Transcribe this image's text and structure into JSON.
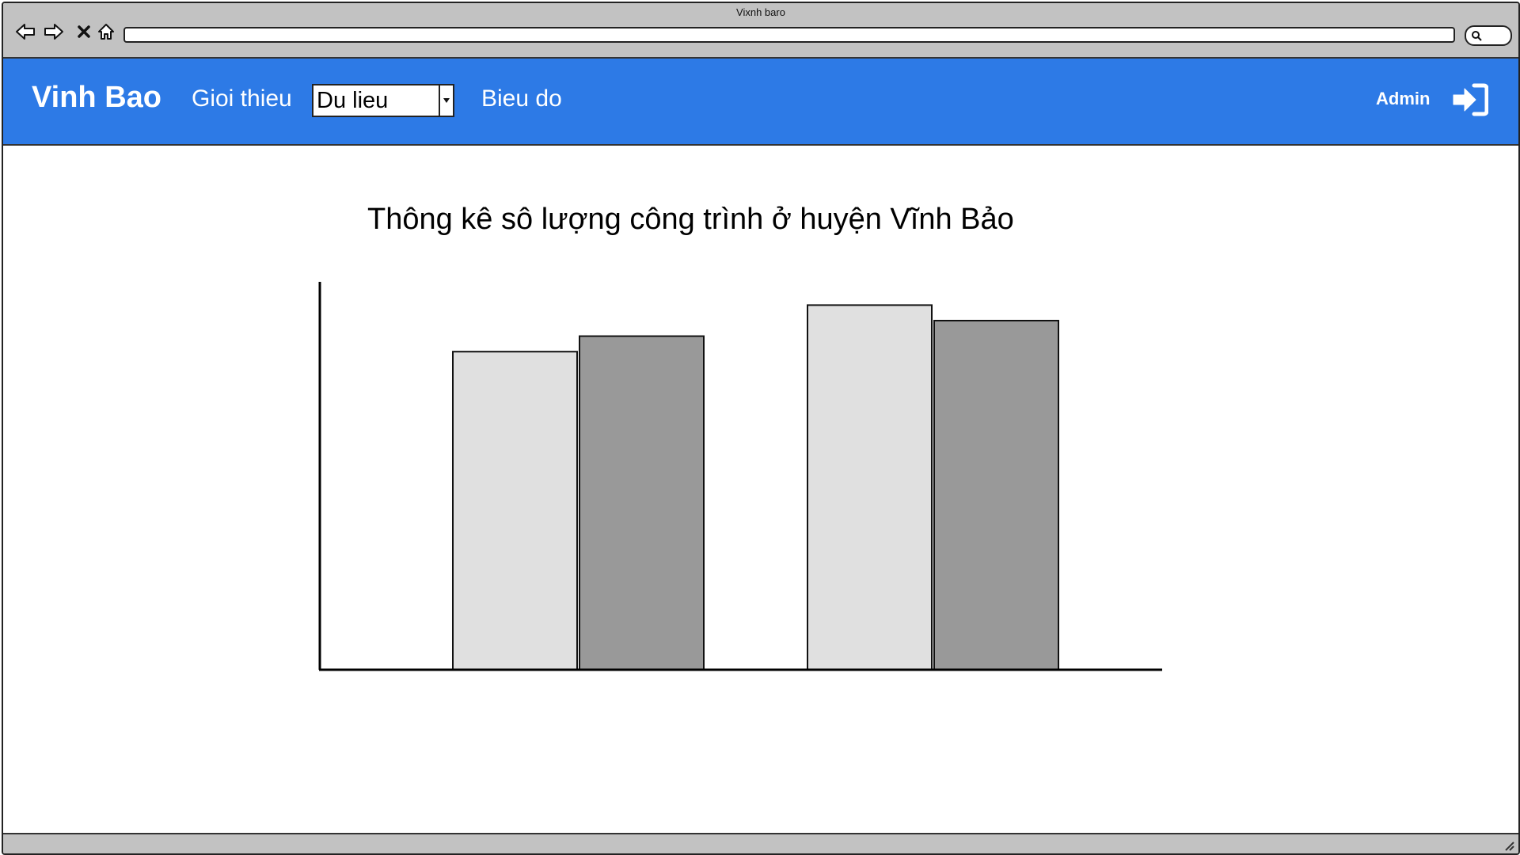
{
  "window": {
    "title": "Vixnh baro"
  },
  "header": {
    "brand": "Vinh Bao",
    "nav_about": "Gioi thieu",
    "nav_data_select": "Du lieu",
    "nav_chart": "Bieu do",
    "user": "Admin"
  },
  "main": {
    "chart_title": "Thông kê sô lượng công trình ở huyện Vĩnh Bảo"
  },
  "icons": {
    "back": "arrow-left-icon",
    "forward": "arrow-right-icon",
    "stop": "close-icon",
    "home": "home-icon",
    "search": "search-icon",
    "logout": "sign-in-icon",
    "dropdown": "caret-down-icon"
  },
  "colors": {
    "header_bg": "#2d7ae6",
    "bar_light": "#e0e0e0",
    "bar_dark": "#999999"
  },
  "chart_data": {
    "type": "bar",
    "categories": [
      "",
      ""
    ],
    "series": [
      {
        "values": [
          82,
          94
        ]
      },
      {
        "values": [
          86,
          90
        ]
      }
    ],
    "title": "Thông kê sô lượng công trình ở huyện Vĩnh Bảo",
    "xlabel": "",
    "ylabel": "",
    "ylim": [
      0,
      100
    ],
    "grid": false
  }
}
